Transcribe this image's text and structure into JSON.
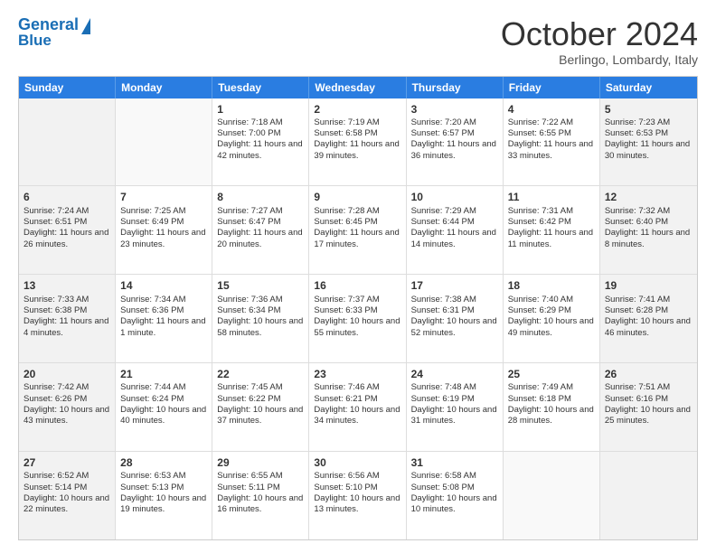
{
  "header": {
    "logo_line1": "General",
    "logo_line2": "Blue",
    "month": "October 2024",
    "location": "Berlingo, Lombardy, Italy"
  },
  "days": [
    "Sunday",
    "Monday",
    "Tuesday",
    "Wednesday",
    "Thursday",
    "Friday",
    "Saturday"
  ],
  "weeks": [
    [
      {
        "day": "",
        "sunrise": "",
        "sunset": "",
        "daylight": "",
        "empty": true
      },
      {
        "day": "",
        "sunrise": "",
        "sunset": "",
        "daylight": "",
        "empty": true
      },
      {
        "day": "1",
        "sunrise": "Sunrise: 7:18 AM",
        "sunset": "Sunset: 7:00 PM",
        "daylight": "Daylight: 11 hours and 42 minutes.",
        "empty": false
      },
      {
        "day": "2",
        "sunrise": "Sunrise: 7:19 AM",
        "sunset": "Sunset: 6:58 PM",
        "daylight": "Daylight: 11 hours and 39 minutes.",
        "empty": false
      },
      {
        "day": "3",
        "sunrise": "Sunrise: 7:20 AM",
        "sunset": "Sunset: 6:57 PM",
        "daylight": "Daylight: 11 hours and 36 minutes.",
        "empty": false
      },
      {
        "day": "4",
        "sunrise": "Sunrise: 7:22 AM",
        "sunset": "Sunset: 6:55 PM",
        "daylight": "Daylight: 11 hours and 33 minutes.",
        "empty": false
      },
      {
        "day": "5",
        "sunrise": "Sunrise: 7:23 AM",
        "sunset": "Sunset: 6:53 PM",
        "daylight": "Daylight: 11 hours and 30 minutes.",
        "empty": false
      }
    ],
    [
      {
        "day": "6",
        "sunrise": "Sunrise: 7:24 AM",
        "sunset": "Sunset: 6:51 PM",
        "daylight": "Daylight: 11 hours and 26 minutes.",
        "empty": false
      },
      {
        "day": "7",
        "sunrise": "Sunrise: 7:25 AM",
        "sunset": "Sunset: 6:49 PM",
        "daylight": "Daylight: 11 hours and 23 minutes.",
        "empty": false
      },
      {
        "day": "8",
        "sunrise": "Sunrise: 7:27 AM",
        "sunset": "Sunset: 6:47 PM",
        "daylight": "Daylight: 11 hours and 20 minutes.",
        "empty": false
      },
      {
        "day": "9",
        "sunrise": "Sunrise: 7:28 AM",
        "sunset": "Sunset: 6:45 PM",
        "daylight": "Daylight: 11 hours and 17 minutes.",
        "empty": false
      },
      {
        "day": "10",
        "sunrise": "Sunrise: 7:29 AM",
        "sunset": "Sunset: 6:44 PM",
        "daylight": "Daylight: 11 hours and 14 minutes.",
        "empty": false
      },
      {
        "day": "11",
        "sunrise": "Sunrise: 7:31 AM",
        "sunset": "Sunset: 6:42 PM",
        "daylight": "Daylight: 11 hours and 11 minutes.",
        "empty": false
      },
      {
        "day": "12",
        "sunrise": "Sunrise: 7:32 AM",
        "sunset": "Sunset: 6:40 PM",
        "daylight": "Daylight: 11 hours and 8 minutes.",
        "empty": false
      }
    ],
    [
      {
        "day": "13",
        "sunrise": "Sunrise: 7:33 AM",
        "sunset": "Sunset: 6:38 PM",
        "daylight": "Daylight: 11 hours and 4 minutes.",
        "empty": false
      },
      {
        "day": "14",
        "sunrise": "Sunrise: 7:34 AM",
        "sunset": "Sunset: 6:36 PM",
        "daylight": "Daylight: 11 hours and 1 minute.",
        "empty": false
      },
      {
        "day": "15",
        "sunrise": "Sunrise: 7:36 AM",
        "sunset": "Sunset: 6:34 PM",
        "daylight": "Daylight: 10 hours and 58 minutes.",
        "empty": false
      },
      {
        "day": "16",
        "sunrise": "Sunrise: 7:37 AM",
        "sunset": "Sunset: 6:33 PM",
        "daylight": "Daylight: 10 hours and 55 minutes.",
        "empty": false
      },
      {
        "day": "17",
        "sunrise": "Sunrise: 7:38 AM",
        "sunset": "Sunset: 6:31 PM",
        "daylight": "Daylight: 10 hours and 52 minutes.",
        "empty": false
      },
      {
        "day": "18",
        "sunrise": "Sunrise: 7:40 AM",
        "sunset": "Sunset: 6:29 PM",
        "daylight": "Daylight: 10 hours and 49 minutes.",
        "empty": false
      },
      {
        "day": "19",
        "sunrise": "Sunrise: 7:41 AM",
        "sunset": "Sunset: 6:28 PM",
        "daylight": "Daylight: 10 hours and 46 minutes.",
        "empty": false
      }
    ],
    [
      {
        "day": "20",
        "sunrise": "Sunrise: 7:42 AM",
        "sunset": "Sunset: 6:26 PM",
        "daylight": "Daylight: 10 hours and 43 minutes.",
        "empty": false
      },
      {
        "day": "21",
        "sunrise": "Sunrise: 7:44 AM",
        "sunset": "Sunset: 6:24 PM",
        "daylight": "Daylight: 10 hours and 40 minutes.",
        "empty": false
      },
      {
        "day": "22",
        "sunrise": "Sunrise: 7:45 AM",
        "sunset": "Sunset: 6:22 PM",
        "daylight": "Daylight: 10 hours and 37 minutes.",
        "empty": false
      },
      {
        "day": "23",
        "sunrise": "Sunrise: 7:46 AM",
        "sunset": "Sunset: 6:21 PM",
        "daylight": "Daylight: 10 hours and 34 minutes.",
        "empty": false
      },
      {
        "day": "24",
        "sunrise": "Sunrise: 7:48 AM",
        "sunset": "Sunset: 6:19 PM",
        "daylight": "Daylight: 10 hours and 31 minutes.",
        "empty": false
      },
      {
        "day": "25",
        "sunrise": "Sunrise: 7:49 AM",
        "sunset": "Sunset: 6:18 PM",
        "daylight": "Daylight: 10 hours and 28 minutes.",
        "empty": false
      },
      {
        "day": "26",
        "sunrise": "Sunrise: 7:51 AM",
        "sunset": "Sunset: 6:16 PM",
        "daylight": "Daylight: 10 hours and 25 minutes.",
        "empty": false
      }
    ],
    [
      {
        "day": "27",
        "sunrise": "Sunrise: 6:52 AM",
        "sunset": "Sunset: 5:14 PM",
        "daylight": "Daylight: 10 hours and 22 minutes.",
        "empty": false
      },
      {
        "day": "28",
        "sunrise": "Sunrise: 6:53 AM",
        "sunset": "Sunset: 5:13 PM",
        "daylight": "Daylight: 10 hours and 19 minutes.",
        "empty": false
      },
      {
        "day": "29",
        "sunrise": "Sunrise: 6:55 AM",
        "sunset": "Sunset: 5:11 PM",
        "daylight": "Daylight: 10 hours and 16 minutes.",
        "empty": false
      },
      {
        "day": "30",
        "sunrise": "Sunrise: 6:56 AM",
        "sunset": "Sunset: 5:10 PM",
        "daylight": "Daylight: 10 hours and 13 minutes.",
        "empty": false
      },
      {
        "day": "31",
        "sunrise": "Sunrise: 6:58 AM",
        "sunset": "Sunset: 5:08 PM",
        "daylight": "Daylight: 10 hours and 10 minutes.",
        "empty": false
      },
      {
        "day": "",
        "sunrise": "",
        "sunset": "",
        "daylight": "",
        "empty": true
      },
      {
        "day": "",
        "sunrise": "",
        "sunset": "",
        "daylight": "",
        "empty": true
      }
    ]
  ]
}
